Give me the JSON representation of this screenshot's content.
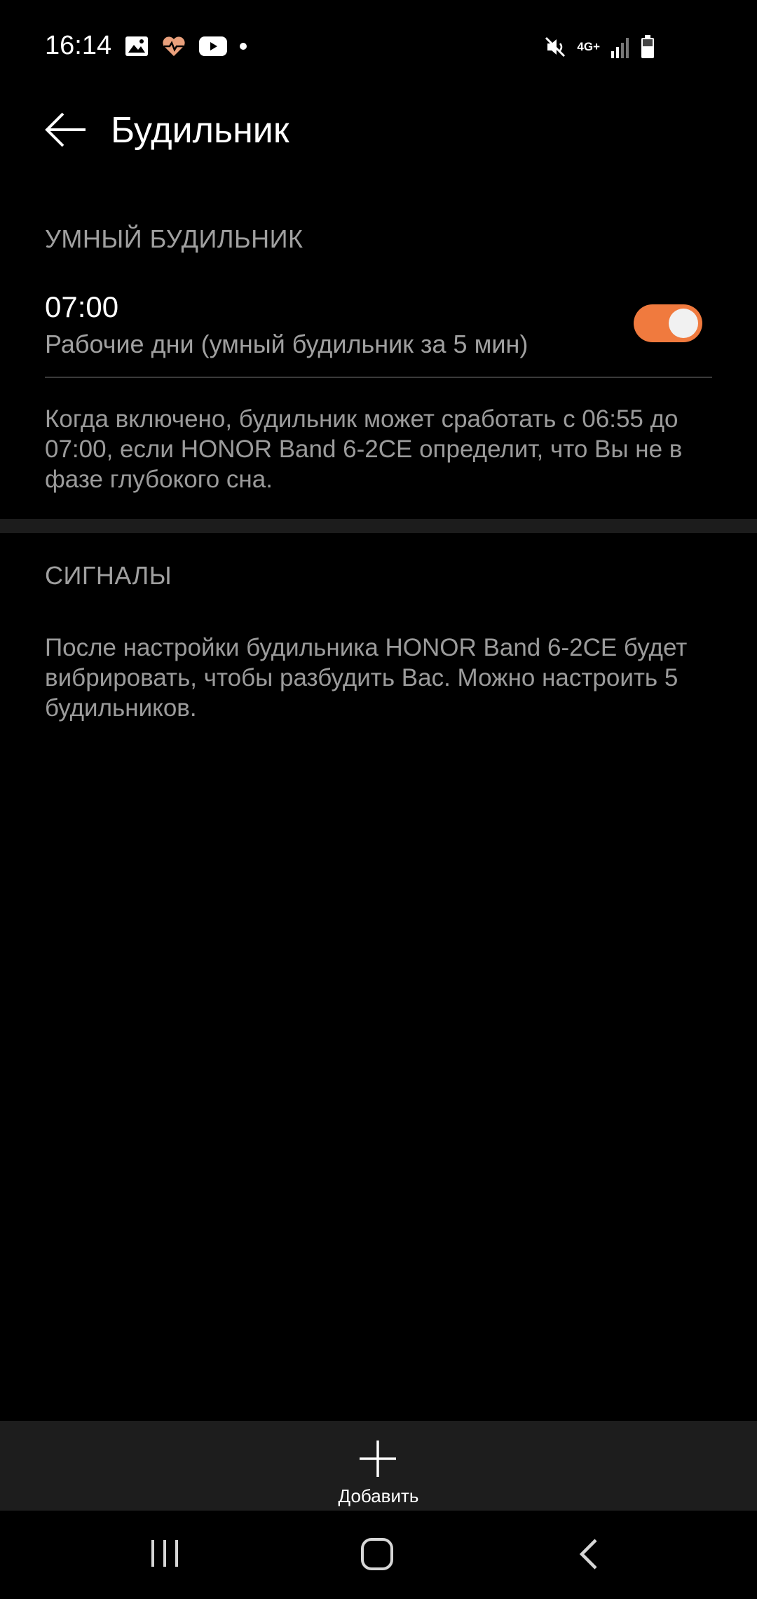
{
  "status": {
    "time": "16:14",
    "network": "4G+"
  },
  "header": {
    "title": "Будильник"
  },
  "smart_alarm": {
    "section_title": "УМНЫЙ БУДИЛЬНИК",
    "time": "07:00",
    "subtitle": "Рабочие дни (умный будильник за 5 мин)",
    "enabled": true,
    "description": "Когда включено, будильник может сработать с 06:55 до 07:00, если HONOR Band 6-2CE определит, что Вы не в фазе глубокого сна."
  },
  "signals": {
    "section_title": "СИГНАЛЫ",
    "description": "После настройки будильника HONOR Band 6-2CE будет вибрировать, чтобы разбудить Вас. Можно настроить 5 будильников."
  },
  "bottom_bar": {
    "add_label": "Добавить"
  },
  "colors": {
    "accent": "#f07a3e",
    "background": "#000000",
    "secondary_text": "#a0a0a0"
  }
}
